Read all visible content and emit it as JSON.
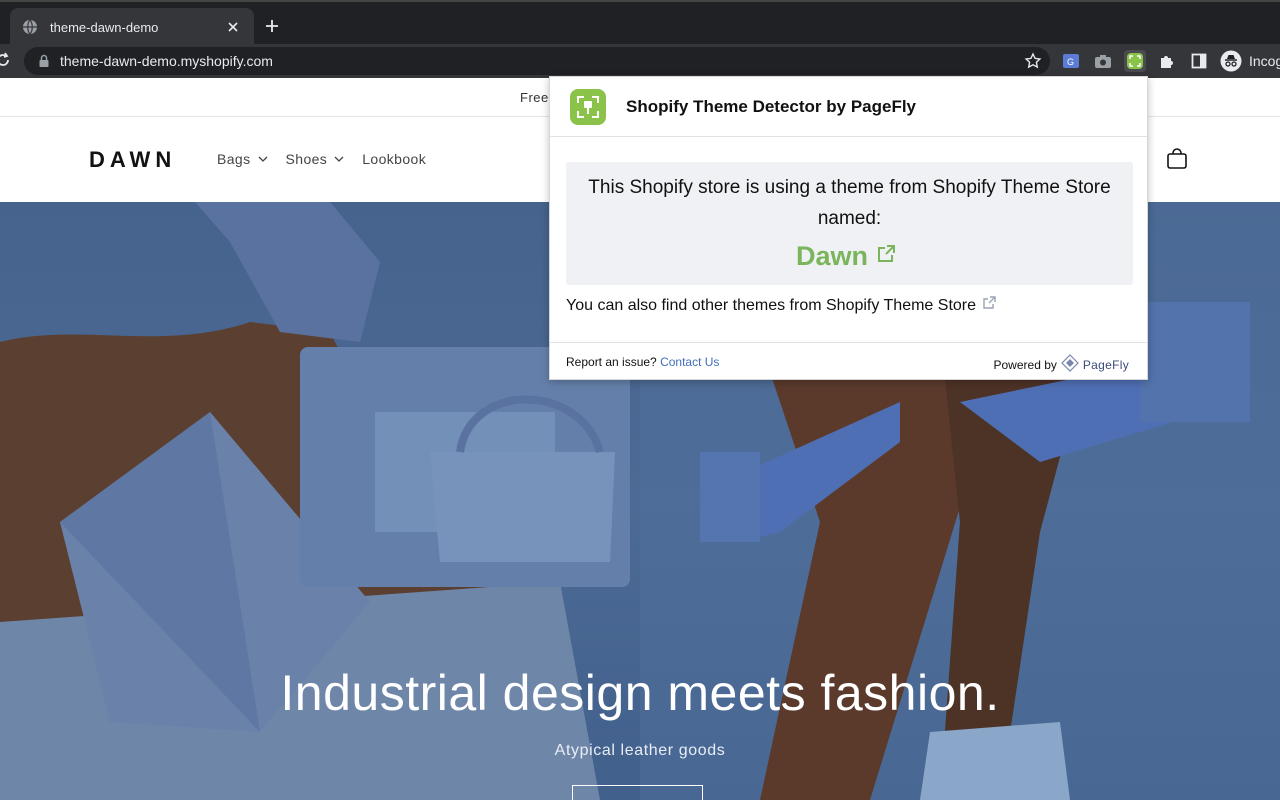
{
  "browser": {
    "tab_title": "theme-dawn-demo",
    "url": "theme-dawn-demo.myshopify.com",
    "profile_label": "Incognito",
    "profile_visible_label": "Incog"
  },
  "icons": {
    "tab_favicon": "globe-icon",
    "tab_close": "close-icon",
    "new_tab": "plus-icon",
    "reload": "reload-icon",
    "lock": "lock-icon",
    "bookmark": "star-icon",
    "extensions": [
      "translate-extension-icon",
      "camera-extension-icon",
      "theme-detector-extension-icon",
      "puzzle-icon",
      "side-panel-icon",
      "incognito-icon"
    ],
    "cart": "cart-icon",
    "external_link": "external-link-icon"
  },
  "store": {
    "announcement": "Free",
    "logo": "DAWN",
    "nav": [
      {
        "label": "Bags",
        "has_dropdown": true
      },
      {
        "label": "Shoes",
        "has_dropdown": true
      },
      {
        "label": "Lookbook",
        "has_dropdown": false
      }
    ],
    "hero": {
      "title": "Industrial design meets fashion.",
      "subtitle": "Atypical leather goods"
    }
  },
  "popup": {
    "title": "Shopify Theme Detector by PageFly",
    "message": "This Shopify store is using a theme from Shopify Theme Store named:",
    "theme_name": "Dawn",
    "other_themes_text": "You can also find other themes from Shopify Theme Store",
    "report_text": "Report an issue?",
    "contact_link": "Contact Us",
    "powered_by": "Powered by",
    "brand": "PageFly"
  },
  "colors": {
    "theme_green": "#7ab55c",
    "link_blue": "#3f6fb5",
    "chrome_dark": "#202124",
    "chrome_toolbar": "#35363a",
    "hero_blue": "#4c6a95"
  }
}
